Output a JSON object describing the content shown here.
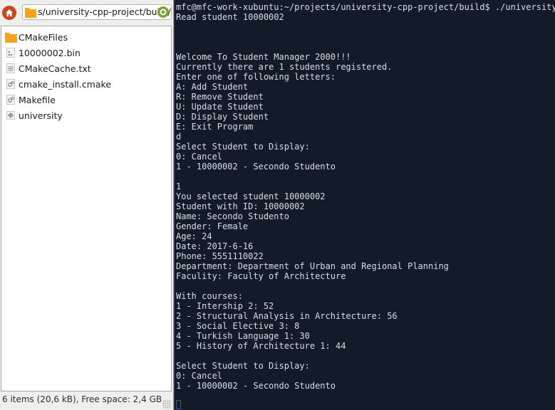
{
  "file_manager": {
    "location_path": "s/university-cpp-project/build/",
    "items": [
      {
        "name": "CMakeFiles",
        "icon": "folder-icon"
      },
      {
        "name": "10000002.bin",
        "icon": "binary-file-icon"
      },
      {
        "name": "CMakeCache.txt",
        "icon": "text-file-icon"
      },
      {
        "name": "cmake_install.cmake",
        "icon": "script-file-icon"
      },
      {
        "name": "Makefile",
        "icon": "script-file-icon"
      },
      {
        "name": "university",
        "icon": "executable-icon"
      }
    ],
    "status": "6 items (20,6 kB), Free space: 2,4 GB"
  },
  "terminal": {
    "lines": [
      "mfc@mfc-work-xubuntu:~/projects/university-cpp-project/build$ ./university",
      "Read student 10000002",
      "",
      "",
      "",
      "Welcome To Student Manager 2000!!!",
      "Currently there are 1 students registered.",
      "Enter one of following letters:",
      "A: Add Student",
      "R: Remove Student",
      "U: Update Student",
      "D: Display Student",
      "E: Exit Program",
      "d",
      "Select Student to Display:",
      "0: Cancel",
      "1 - 10000002 - Secondo Studento",
      "",
      "1",
      "You selected student 10000002",
      "Student with ID: 10000002",
      "Name: Secondo Studento",
      "Gender: Female",
      "Age: 24",
      "Date: 2017-6-16",
      "Phone: 5551110022",
      "Department: Department of Urban and Regional Planning",
      "Faculity: Faculty of Architecture",
      "",
      "With courses:",
      "1 - Intership 2: 52",
      "2 - Structural Analysis in Architecture: 56",
      "3 - Social Elective 3: 8",
      "4 - Turkish Language 1: 30",
      "5 - History of Architecture 1: 44",
      "",
      "Select Student to Display:",
      "0: Cancel",
      "1 - 10000002 - Secondo Studento"
    ]
  },
  "colors": {
    "terminal_bg": "#131a28",
    "terminal_fg": "#d8dde6",
    "folder": "#f7a21b",
    "home": "#c8481e",
    "refresh": "#78a22f"
  }
}
